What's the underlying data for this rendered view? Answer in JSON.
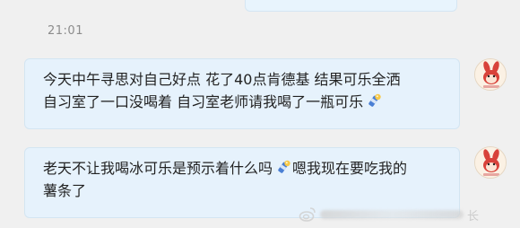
{
  "chat": {
    "timestamp": "21:01",
    "messages": [
      {
        "lines": [
          "今天中午寻思对自己好点 花了40点肯德基 结果可乐全洒",
          "自习室了一口没喝着 自习室老师请我喝了一瓶可乐"
        ],
        "emoji": "cola-icon"
      },
      {
        "line1": "老天不让我喝冰可乐是预示着什么吗",
        "line1_after_emoji": "嗯我现在要吃我的",
        "line2": "薯条了",
        "emoji": "cola-icon"
      }
    ]
  },
  "watermark": {
    "logo": "weibo-logo-icon",
    "trailing_char": "长"
  },
  "colors": {
    "background": "#f0f0f0",
    "bubble": "#e6f2fc",
    "bubble_border": "#d3e5f2",
    "text": "#222222",
    "timestamp": "#8c8c8c"
  }
}
